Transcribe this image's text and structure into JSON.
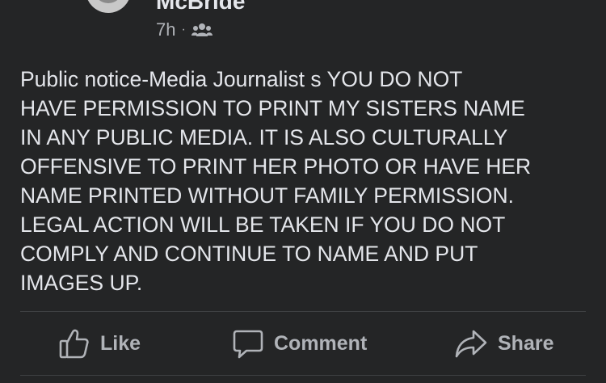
{
  "post": {
    "author_name": "McBride",
    "timestamp": "7h",
    "separator": "·",
    "audience_icon": "friends-icon",
    "text": "Public notice-Media Journalist s YOU DO NOT\nHAVE PERMISSION TO PRINT MY SISTERS NAME\nIN ANY PUBLIC MEDIA. IT IS ALSO CULTURALLY\nOFFENSIVE TO PRINT HER PHOTO OR HAVE HER\nNAME PRINTED WITHOUT FAMILY PERMISSION.\nLEGAL ACTION WILL BE TAKEN IF YOU DO NOT\nCOMPLY AND CONTINUE TO NAME AND PUT\nIMAGES UP."
  },
  "actions": {
    "like_label": "Like",
    "comment_label": "Comment",
    "share_label": "Share"
  },
  "colors": {
    "background": "#242526",
    "primary_text": "#e4e6eb",
    "secondary_text": "#b0b3b8",
    "divider": "#3e4042"
  }
}
